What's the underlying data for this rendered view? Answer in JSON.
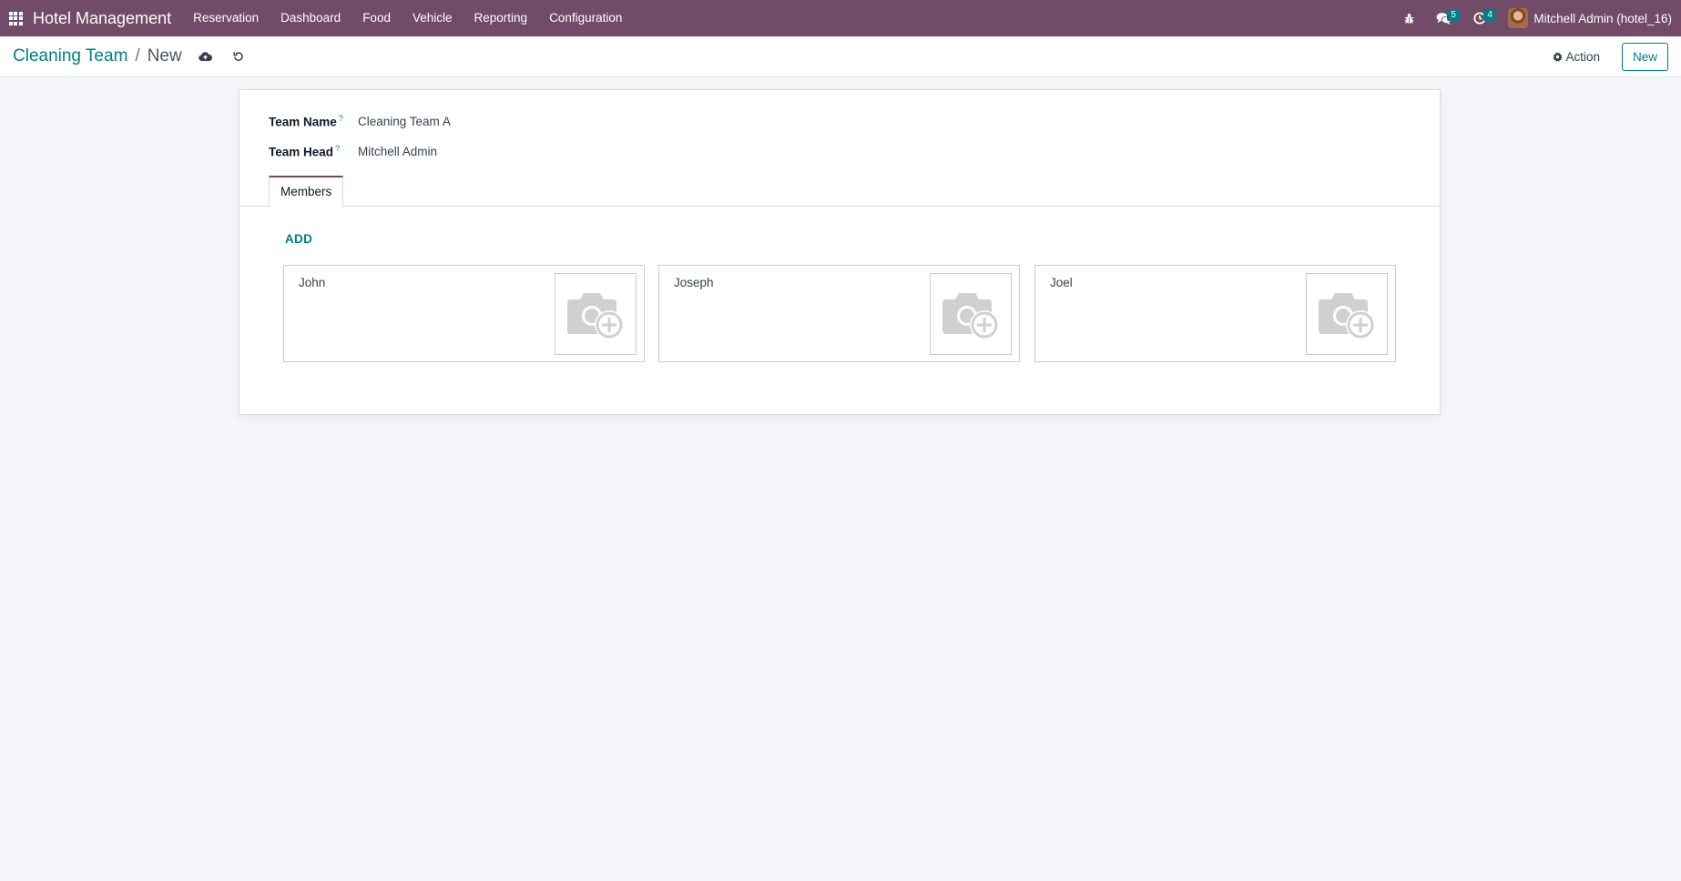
{
  "navbar": {
    "app_name": "Hotel Management",
    "menu": [
      "Reservation",
      "Dashboard",
      "Food",
      "Vehicle",
      "Reporting",
      "Configuration"
    ],
    "messages_count": "5",
    "activities_count": "4",
    "user": "Mitchell Admin (hotel_16)",
    "bg_color": "#714b67"
  },
  "control_panel": {
    "breadcrumb_parent": "Cleaning Team",
    "breadcrumb_separator": "/",
    "breadcrumb_current": "New",
    "action_label": "Action",
    "new_label": "New"
  },
  "form": {
    "team_name_label": "Team Name",
    "team_name_value": "Cleaning Team A",
    "team_head_label": "Team Head",
    "team_head_value": "Mitchell Admin",
    "help_marker": "?"
  },
  "tabs": {
    "members_label": "Members"
  },
  "members": {
    "add_label": "ADD",
    "items": [
      {
        "name": "John"
      },
      {
        "name": "Joseph"
      },
      {
        "name": "Joel"
      }
    ]
  },
  "colors": {
    "accent": "#017e84",
    "navbar": "#714b67",
    "background": "#f5f6f9"
  },
  "icons": {
    "apps": "apps-grid-icon",
    "bug": "bug-icon",
    "messages": "chat-icon",
    "activities": "clock-icon",
    "save": "cloud-upload-icon",
    "discard": "undo-icon",
    "action": "gear-icon",
    "photo": "camera-plus-icon"
  }
}
